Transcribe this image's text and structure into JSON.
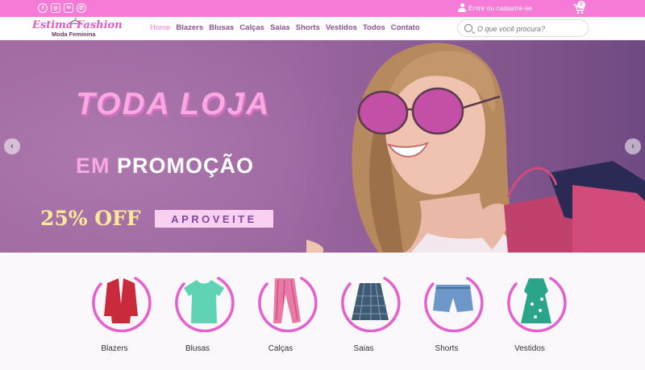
{
  "topbar": {
    "social": [
      {
        "icon": "facebook-icon",
        "glyph": "f"
      },
      {
        "icon": "instagram-icon",
        "glyph": "◎"
      },
      {
        "icon": "linkedin-icon",
        "glyph": "in"
      },
      {
        "icon": "whatsapp-icon",
        "glyph": "✆"
      }
    ],
    "login_label": "Entre ou cadastre-se",
    "cart_count": "0"
  },
  "header": {
    "brand": "Estima Fashion",
    "tagline": "Moda Feminina",
    "nav": [
      "Home",
      "Blazers",
      "Blusas",
      "Calças",
      "Saias",
      "Shorts",
      "Vestidos",
      "Todos",
      "Contato"
    ],
    "active_nav": "Home",
    "search_placeholder": "O que você procura?"
  },
  "banner": {
    "headline": "TODA LOJA",
    "subheadline_prefix": "EM",
    "subheadline": "PROMOÇÃO",
    "offer": "25% OFF",
    "cta": "APROVEITE",
    "prev_glyph": "‹",
    "next_glyph": "›"
  },
  "categories": [
    {
      "label": "Blazers",
      "icon": "blazer-icon"
    },
    {
      "label": "Blusas",
      "icon": "blouse-icon"
    },
    {
      "label": "Calças",
      "icon": "pants-icon"
    },
    {
      "label": "Saias",
      "icon": "skirt-icon"
    },
    {
      "label": "Shorts",
      "icon": "shorts-icon"
    },
    {
      "label": "Vestidos",
      "icon": "dress-icon"
    }
  ],
  "colors": {
    "brand_pink": "#f57bd6",
    "nav_purple": "#8c5294",
    "ring_pink": "#e65fcf"
  }
}
